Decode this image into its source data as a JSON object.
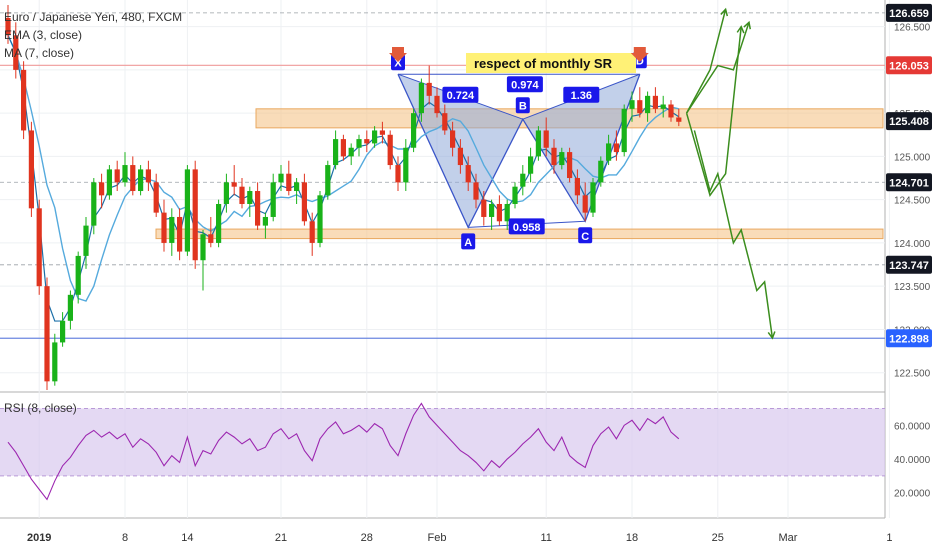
{
  "header": {
    "symbol": "Euro / Japanese Yen, 480, FXCM",
    "ema": "EMA (3, close)",
    "ma": "MA (7, close)",
    "rsi": "RSI (8, close)"
  },
  "colors": {
    "up": "#19b219",
    "down": "#e0341f",
    "ema": "#1b6fa8",
    "ma": "#55aadd",
    "rsi": "#9c27b0",
    "pattern_fill": "#8fa9d8",
    "pattern_line": "#3a55c8",
    "zone": "#f5c48a",
    "resist_line": "#ef9a9a",
    "support_line": "#6b87e0",
    "arrow_green": "#3b8d1e",
    "label_bg": "#1a18ea",
    "note_bg": "#fff176"
  },
  "chart_data": {
    "type": "candlestick",
    "symbol": "Euro / Japanese Yen",
    "timeframe": "480",
    "source": "FXCM",
    "ylim": [
      122.3,
      126.75
    ],
    "y_ticks": [
      122.5,
      123.0,
      123.5,
      124.0,
      124.5,
      125.0,
      125.5,
      126.0,
      126.5
    ],
    "x_ticks": [
      "2019",
      "8",
      "14",
      "21",
      "28",
      "Feb",
      "11",
      "18",
      "25",
      "Mar",
      "1"
    ],
    "price_labels": [
      {
        "value": "126.659",
        "style": "dark"
      },
      {
        "value": "126.053",
        "style": "red"
      },
      {
        "value": "125.408",
        "style": "dark"
      },
      {
        "value": "124.701",
        "style": "dark"
      },
      {
        "value": "123.747",
        "style": "dark"
      },
      {
        "value": "122.898",
        "style": "blue"
      }
    ],
    "ohlc": [
      [
        126.6,
        126.75,
        126.3,
        126.4
      ],
      [
        126.4,
        126.55,
        125.9,
        126.0
      ],
      [
        126.0,
        126.1,
        125.2,
        125.3
      ],
      [
        125.3,
        125.4,
        124.3,
        124.4
      ],
      [
        124.4,
        124.5,
        123.4,
        123.5
      ],
      [
        123.5,
        123.6,
        122.3,
        122.4
      ],
      [
        122.4,
        122.95,
        122.35,
        122.85
      ],
      [
        122.85,
        123.2,
        122.8,
        123.1
      ],
      [
        123.1,
        123.45,
        123.0,
        123.4
      ],
      [
        123.4,
        123.9,
        123.3,
        123.85
      ],
      [
        123.85,
        124.3,
        123.7,
        124.2
      ],
      [
        124.2,
        124.75,
        124.1,
        124.7
      ],
      [
        124.7,
        124.8,
        124.4,
        124.55
      ],
      [
        124.55,
        124.9,
        124.5,
        124.85
      ],
      [
        124.85,
        124.95,
        124.6,
        124.7
      ],
      [
        124.7,
        125.05,
        124.65,
        124.9
      ],
      [
        124.9,
        125.0,
        124.55,
        124.6
      ],
      [
        124.6,
        124.9,
        124.55,
        124.85
      ],
      [
        124.85,
        124.95,
        124.6,
        124.7
      ],
      [
        124.7,
        124.8,
        124.3,
        124.35
      ],
      [
        124.35,
        124.5,
        123.9,
        124.0
      ],
      [
        124.0,
        124.4,
        123.85,
        124.3
      ],
      [
        124.3,
        124.4,
        123.8,
        123.9
      ],
      [
        123.9,
        124.9,
        123.85,
        124.85
      ],
      [
        124.85,
        124.95,
        123.7,
        123.8
      ],
      [
        123.8,
        124.15,
        123.45,
        124.1
      ],
      [
        124.1,
        124.3,
        123.95,
        124.0
      ],
      [
        124.0,
        124.5,
        123.95,
        124.45
      ],
      [
        124.45,
        124.8,
        124.35,
        124.7
      ],
      [
        124.7,
        124.9,
        124.55,
        124.65
      ],
      [
        124.65,
        124.75,
        124.4,
        124.45
      ],
      [
        124.45,
        124.65,
        124.3,
        124.6
      ],
      [
        124.6,
        124.7,
        124.15,
        124.2
      ],
      [
        124.2,
        124.35,
        124.05,
        124.3
      ],
      [
        124.3,
        124.8,
        124.25,
        124.7
      ],
      [
        124.7,
        124.9,
        124.6,
        124.8
      ],
      [
        124.8,
        124.95,
        124.55,
        124.6
      ],
      [
        124.6,
        124.75,
        124.45,
        124.7
      ],
      [
        124.7,
        124.8,
        124.2,
        124.25
      ],
      [
        124.25,
        124.35,
        123.85,
        124.0
      ],
      [
        124.0,
        124.6,
        123.95,
        124.55
      ],
      [
        124.55,
        124.95,
        124.5,
        124.9
      ],
      [
        124.9,
        125.3,
        124.85,
        125.2
      ],
      [
        125.2,
        125.25,
        124.95,
        125.0
      ],
      [
        125.0,
        125.15,
        124.9,
        125.1
      ],
      [
        125.1,
        125.25,
        125.0,
        125.2
      ],
      [
        125.2,
        125.3,
        125.05,
        125.15
      ],
      [
        125.15,
        125.35,
        125.1,
        125.3
      ],
      [
        125.3,
        125.4,
        125.15,
        125.25
      ],
      [
        125.25,
        125.3,
        124.85,
        124.9
      ],
      [
        124.9,
        125.0,
        124.6,
        124.7
      ],
      [
        124.7,
        125.2,
        124.6,
        125.1
      ],
      [
        125.1,
        125.55,
        125.05,
        125.5
      ],
      [
        125.5,
        125.9,
        125.4,
        125.85
      ],
      [
        125.85,
        126.05,
        125.6,
        125.7
      ],
      [
        125.7,
        125.8,
        125.45,
        125.5
      ],
      [
        125.5,
        125.6,
        125.25,
        125.3
      ],
      [
        125.3,
        125.4,
        125.0,
        125.1
      ],
      [
        125.1,
        125.2,
        124.8,
        124.9
      ],
      [
        124.9,
        125.0,
        124.6,
        124.7
      ],
      [
        124.7,
        124.8,
        124.4,
        124.5
      ],
      [
        124.5,
        124.6,
        124.2,
        124.3
      ],
      [
        124.3,
        124.5,
        124.15,
        124.45
      ],
      [
        124.45,
        124.55,
        124.2,
        124.25
      ],
      [
        124.25,
        124.5,
        124.15,
        124.45
      ],
      [
        124.45,
        124.7,
        124.4,
        124.65
      ],
      [
        124.65,
        124.9,
        124.55,
        124.8
      ],
      [
        124.8,
        125.1,
        124.7,
        125.0
      ],
      [
        125.0,
        125.35,
        124.95,
        125.3
      ],
      [
        125.3,
        125.45,
        125.0,
        125.1
      ],
      [
        125.1,
        125.2,
        124.8,
        124.9
      ],
      [
        124.9,
        125.1,
        124.85,
        125.05
      ],
      [
        125.05,
        125.1,
        124.7,
        124.75
      ],
      [
        124.75,
        124.85,
        124.45,
        124.55
      ],
      [
        124.55,
        124.7,
        124.25,
        124.35
      ],
      [
        124.35,
        124.75,
        124.3,
        124.7
      ],
      [
        124.7,
        125.0,
        124.65,
        124.95
      ],
      [
        124.95,
        125.25,
        124.9,
        125.15
      ],
      [
        125.15,
        125.3,
        124.95,
        125.05
      ],
      [
        125.05,
        125.6,
        125.0,
        125.55
      ],
      [
        125.55,
        125.75,
        125.4,
        125.65
      ],
      [
        125.65,
        125.8,
        125.45,
        125.5
      ],
      [
        125.5,
        125.75,
        125.4,
        125.7
      ],
      [
        125.7,
        125.8,
        125.5,
        125.55
      ],
      [
        125.55,
        125.7,
        125.45,
        125.6
      ],
      [
        125.6,
        125.65,
        125.4,
        125.45
      ],
      [
        125.45,
        125.55,
        125.35,
        125.4
      ]
    ],
    "pattern": {
      "name": "bearish bat",
      "points": [
        {
          "label": "X",
          "bar": 50,
          "price": 125.95
        },
        {
          "label": "A",
          "bar": 59,
          "price": 124.18
        },
        {
          "label": "B",
          "bar": 66,
          "price": 125.43
        },
        {
          "label": "C",
          "bar": 74,
          "price": 124.25
        },
        {
          "label": "D",
          "bar": 81,
          "price": 125.95
        }
      ],
      "ratios": [
        "0.724",
        "1.36",
        "0.974",
        "0.958"
      ]
    },
    "annotation": "respect of monthly SR",
    "zones": [
      {
        "from": 125.33,
        "to": 125.55,
        "label": "resistance zone"
      },
      {
        "from": 124.05,
        "to": 124.16,
        "label": "support zone"
      }
    ],
    "lines": [
      {
        "value": 126.053,
        "color": "red"
      },
      {
        "value": 122.898,
        "color": "blue"
      },
      {
        "value": 126.659,
        "style": "dashed"
      },
      {
        "value": 124.701,
        "style": "dashed"
      },
      {
        "value": 123.747,
        "style": "dashed"
      }
    ],
    "projections": [
      [
        [
          87,
          125.5
        ],
        [
          90,
          126.0
        ],
        [
          92,
          126.7
        ]
      ],
      [
        [
          87,
          125.5
        ],
        [
          91,
          126.05
        ],
        [
          93,
          126.0
        ],
        [
          95,
          126.55
        ]
      ],
      [
        [
          87,
          125.5
        ],
        [
          90,
          124.55
        ],
        [
          92,
          124.8
        ],
        [
          94,
          126.5
        ]
      ],
      [
        [
          88,
          125.3
        ],
        [
          90,
          124.6
        ],
        [
          91,
          124.8
        ],
        [
          93,
          124.0
        ],
        [
          94,
          124.15
        ],
        [
          96,
          123.45
        ],
        [
          97,
          123.55
        ],
        [
          98,
          122.9
        ]
      ]
    ],
    "rsi": {
      "label": "RSI (8, close)",
      "ylim": [
        5,
        78
      ],
      "levels": [
        70,
        30
      ],
      "ticks": [
        20,
        40,
        60
      ],
      "values": [
        50,
        44,
        36,
        28,
        22,
        16,
        27,
        36,
        41,
        48,
        54,
        57,
        53,
        56,
        52,
        55,
        47,
        52,
        49,
        44,
        36,
        42,
        38,
        53,
        36,
        45,
        43,
        51,
        56,
        53,
        49,
        52,
        45,
        47,
        55,
        58,
        52,
        55,
        45,
        39,
        52,
        58,
        62,
        55,
        57,
        60,
        56,
        61,
        58,
        48,
        42,
        55,
        66,
        73,
        65,
        60,
        55,
        50,
        45,
        42,
        38,
        33,
        39,
        35,
        40,
        44,
        49,
        53,
        58,
        50,
        45,
        53,
        42,
        38,
        35,
        48,
        55,
        59,
        52,
        60,
        63,
        57,
        64,
        61,
        65,
        56,
        52
      ]
    }
  },
  "y_tick_labels": [
    "122.500",
    "123.000",
    "123.500",
    "124.000",
    "124.500",
    "125.000",
    "125.500",
    "126.000",
    "126.500"
  ],
  "rsi_tick_labels": [
    "20.0000",
    "40.0000",
    "60.0000"
  ]
}
